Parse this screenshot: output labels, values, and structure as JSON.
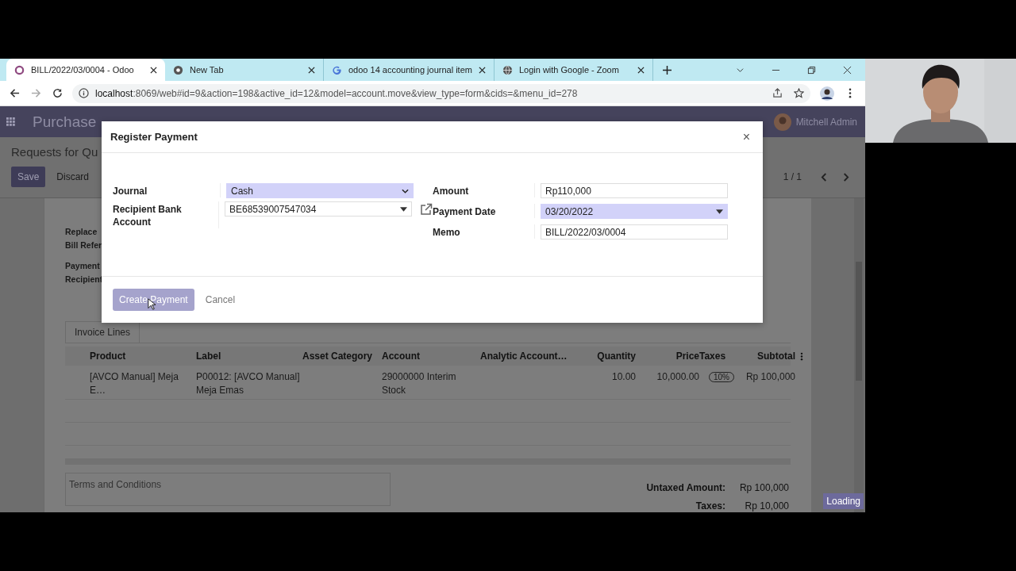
{
  "browser": {
    "tabs": [
      {
        "title": "BILL/2022/03/0004 - Odoo",
        "selected": true
      },
      {
        "title": "New Tab",
        "selected": false
      },
      {
        "title": "odoo 14 accounting journal item",
        "selected": false
      },
      {
        "title": "Login with Google - Zoom",
        "selected": false
      }
    ],
    "url_host": "localhost",
    "url_path": ":8069/web#id=9&action=198&active_id=12&model=account.move&view_type=form&cids=&menu_id=278"
  },
  "navbar": {
    "app": "Purchase",
    "user": "Mitchell Admin"
  },
  "control_panel": {
    "breadcrumb": "Requests for Qu",
    "buttons": [
      "Save",
      "Discard"
    ],
    "pager": "1 / 1"
  },
  "form_labels": [
    "Replace",
    "Bill Refer",
    "Payment",
    "Recipient"
  ],
  "notebook_tab": "Invoice Lines",
  "table": {
    "columns": [
      "Product",
      "Label",
      "Asset Category",
      "Account",
      "Analytic Account…",
      "Quantity",
      "Price",
      "Taxes",
      "Subtotal"
    ],
    "rows": [
      [
        "[AVCO Manual] Meja E…",
        "P00012: [AVCO Manual] Meja Emas",
        "",
        "29000000 Interim Stock",
        "",
        "10.00",
        "10,000.00",
        "10%",
        "Rp 100,000"
      ]
    ]
  },
  "terms": {
    "placeholder": "Terms and Conditions"
  },
  "totals": [
    {
      "label": "Untaxed Amount:",
      "value": "Rp 100,000"
    },
    {
      "label": "Taxes:",
      "value": "Rp 10,000"
    }
  ],
  "loading": "Loading",
  "modal": {
    "title": "Register Payment",
    "close": "×",
    "left_fields": [
      {
        "label": "Journal",
        "value": "Cash",
        "kind": "select",
        "required": true,
        "link": false
      },
      {
        "label": "Recipient Bank Account",
        "value": "BE68539007547034",
        "kind": "many2one",
        "required": false,
        "link": true
      }
    ],
    "right_fields": [
      {
        "label": "Amount",
        "value": "Rp110,000",
        "kind": "text",
        "required": false,
        "link": false
      },
      {
        "label": "Payment Date",
        "value": "03/20/2022",
        "kind": "date",
        "required": true,
        "link": false
      },
      {
        "label": "Memo",
        "value": "BILL/2022/03/0004",
        "kind": "text",
        "required": false,
        "link": false
      }
    ],
    "primary_button": "Create Payment",
    "secondary_button": "Cancel"
  }
}
